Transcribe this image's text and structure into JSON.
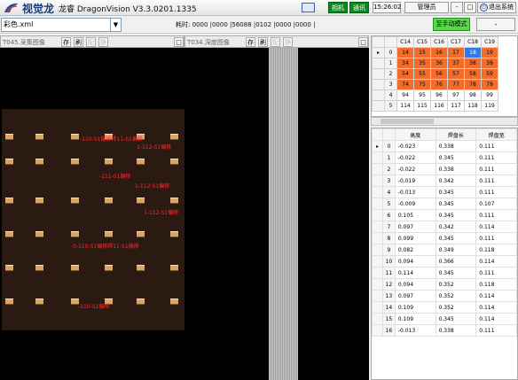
{
  "app": {
    "brand": "视觉龙",
    "title": "龙睿 DragonVision V3.3.0201.1335",
    "status_1": "相机",
    "status_2": "通讯",
    "clock": "15:26:02",
    "user": "管理员",
    "minimize": "-",
    "maximize": "□",
    "exit_label": "退出系统"
  },
  "toolbar": {
    "file": "彩色.xml",
    "timing": "耗时: 0000 |0000 |56088 |0102 |0000 |0000 |",
    "manual_mode": "至手动模式",
    "minus": "-"
  },
  "left_panel": {
    "title": "T045.采集图像",
    "save": "存",
    "refresh": "刷",
    "config": "配",
    "static": "静",
    "close": "□"
  },
  "right_panel": {
    "title": "T034.深度图像",
    "save": "存",
    "refresh": "刷",
    "config": "配",
    "static": "静",
    "close": "□"
  },
  "image_labels": [
    "-110-S1偏移焊11-S1偏移",
    "1-112-S1偏移",
    "-111-S1偏移",
    "1-112-S1偏移",
    "1-112-S1偏移",
    "0-110-S1偏移焊11-S1偏移",
    "-110-S1偏移"
  ],
  "grid": {
    "columns": [
      "C14",
      "C15",
      "C16",
      "C17",
      "C18",
      "C19"
    ],
    "rows": [
      {
        "idx": "0",
        "cells": [
          "14",
          "15",
          "16",
          "17",
          "18",
          "19"
        ]
      },
      {
        "idx": "1",
        "cells": [
          "34",
          "35",
          "36",
          "37",
          "38",
          "39"
        ]
      },
      {
        "idx": "2",
        "cells": [
          "54",
          "55",
          "56",
          "57",
          "58",
          "59"
        ]
      },
      {
        "idx": "3",
        "cells": [
          "74",
          "75",
          "76",
          "77",
          "78",
          "79"
        ]
      },
      {
        "idx": "4",
        "cells": [
          "94",
          "95",
          "96",
          "97",
          "98",
          "99"
        ]
      },
      {
        "idx": "5",
        "cells": [
          "114",
          "115",
          "116",
          "117",
          "118",
          "119"
        ]
      }
    ]
  },
  "pad_table": {
    "headers": [
      "高度",
      "焊盘长",
      "焊盘宽"
    ],
    "rows": [
      {
        "idx": "0",
        "h": "-0.023",
        "l": "0.338",
        "w": "0.111"
      },
      {
        "idx": "1",
        "h": "-0.022",
        "l": "0.345",
        "w": "0.111"
      },
      {
        "idx": "2",
        "h": "-0.022",
        "l": "0.338",
        "w": "0.111"
      },
      {
        "idx": "3",
        "h": "-0.019",
        "l": "0.342",
        "w": "0.111"
      },
      {
        "idx": "4",
        "h": "-0.013",
        "l": "0.345",
        "w": "0.111"
      },
      {
        "idx": "5",
        "h": "-0.009",
        "l": "0.345",
        "w": "0.107"
      },
      {
        "idx": "6",
        "h": "0.105",
        "l": "0.345",
        "w": "0.111"
      },
      {
        "idx": "7",
        "h": "0.097",
        "l": "0.342",
        "w": "0.114"
      },
      {
        "idx": "8",
        "h": "0.099",
        "l": "0.345",
        "w": "0.111"
      },
      {
        "idx": "9",
        "h": "0.082",
        "l": "0.349",
        "w": "0.118"
      },
      {
        "idx": "10",
        "h": "0.094",
        "l": "0.366",
        "w": "0.114"
      },
      {
        "idx": "11",
        "h": "0.114",
        "l": "0.345",
        "w": "0.111"
      },
      {
        "idx": "12",
        "h": "0.094",
        "l": "0.352",
        "w": "0.118"
      },
      {
        "idx": "13",
        "h": "0.097",
        "l": "0.352",
        "w": "0.114"
      },
      {
        "idx": "14",
        "h": "0.109",
        "l": "0.352",
        "w": "0.114"
      },
      {
        "idx": "15",
        "h": "0.109",
        "l": "0.345",
        "w": "0.114"
      },
      {
        "idx": "16",
        "h": "-0.013",
        "l": "0.338",
        "w": "0.111"
      }
    ]
  },
  "colors": {
    "highlight": "#f46c2c",
    "selected": "#2d7be6",
    "status_green": "#0c8a1e",
    "mode_green": "#5ad84c"
  }
}
